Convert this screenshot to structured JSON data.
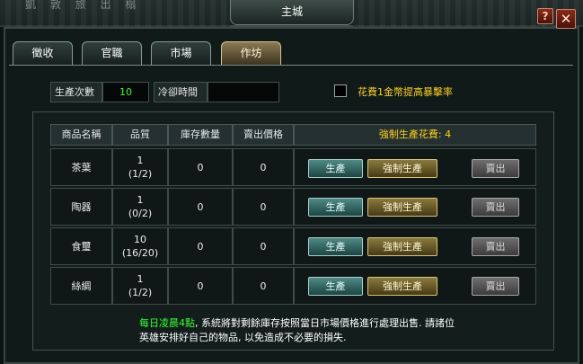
{
  "window": {
    "title": "主城",
    "help_label": "?",
    "close_label": "✕",
    "top_faded_text": "凱 敦 旅 出 榻"
  },
  "tabs": [
    {
      "label": "徵收",
      "active": false
    },
    {
      "label": "官職",
      "active": false
    },
    {
      "label": "市場",
      "active": false
    },
    {
      "label": "作坊",
      "active": true
    }
  ],
  "info": {
    "production_count_label": "生產次數",
    "production_count_value": "10",
    "cooldown_label": "冷卻時間",
    "cooldown_value": "",
    "checkbox_checked": false,
    "checkbox_label": "花費1金幣提高暴擊率"
  },
  "table": {
    "headers": {
      "name": "商品名稱",
      "quality": "品質",
      "stock": "庫存數量",
      "price": "賣出價格",
      "force_cost": "強制生產花費: 4"
    },
    "rows": [
      {
        "name": "茶葉",
        "quality": "1",
        "quality_sub": "(1/2)",
        "stock": "0",
        "price": "0"
      },
      {
        "name": "陶器",
        "quality": "1",
        "quality_sub": "(0/2)",
        "stock": "0",
        "price": "0"
      },
      {
        "name": "食璽",
        "quality": "10",
        "quality_sub": "(16/20)",
        "stock": "0",
        "price": "0"
      },
      {
        "name": "絲綢",
        "quality": "1",
        "quality_sub": "(1/2)",
        "stock": "0",
        "price": "0"
      }
    ],
    "buttons": {
      "produce": "生產",
      "force_produce": "強制生產",
      "sell": "賣出"
    }
  },
  "notice": {
    "highlight": "每日凌晨4點",
    "text": ", 系統將對剩餘庫存按照當日市場價格進行處理出售. 請諸位英雄安排好自己的物品, 以免造成不必要的損失."
  },
  "colors": {
    "accent_green": "#33ff33",
    "accent_gold": "#ffd21a",
    "active_tab": "#8a7a52"
  }
}
